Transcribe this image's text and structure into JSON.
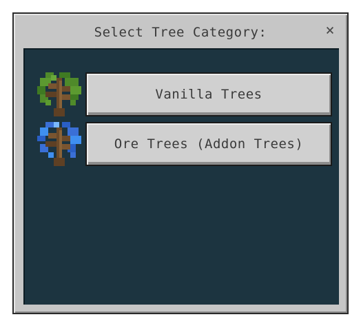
{
  "dialog": {
    "title": "Select Tree Category:",
    "close_label": "×"
  },
  "categories": [
    {
      "label": "Vanilla Trees",
      "icon": "oak-tree-icon"
    },
    {
      "label": "Ore Trees (Addon Trees)",
      "icon": "ore-tree-icon"
    }
  ],
  "colors": {
    "dialog_bg": "#c6c6c6",
    "content_bg": "#1c3440",
    "button_bg": "#d0d0d0",
    "text": "#3a3a3a"
  }
}
